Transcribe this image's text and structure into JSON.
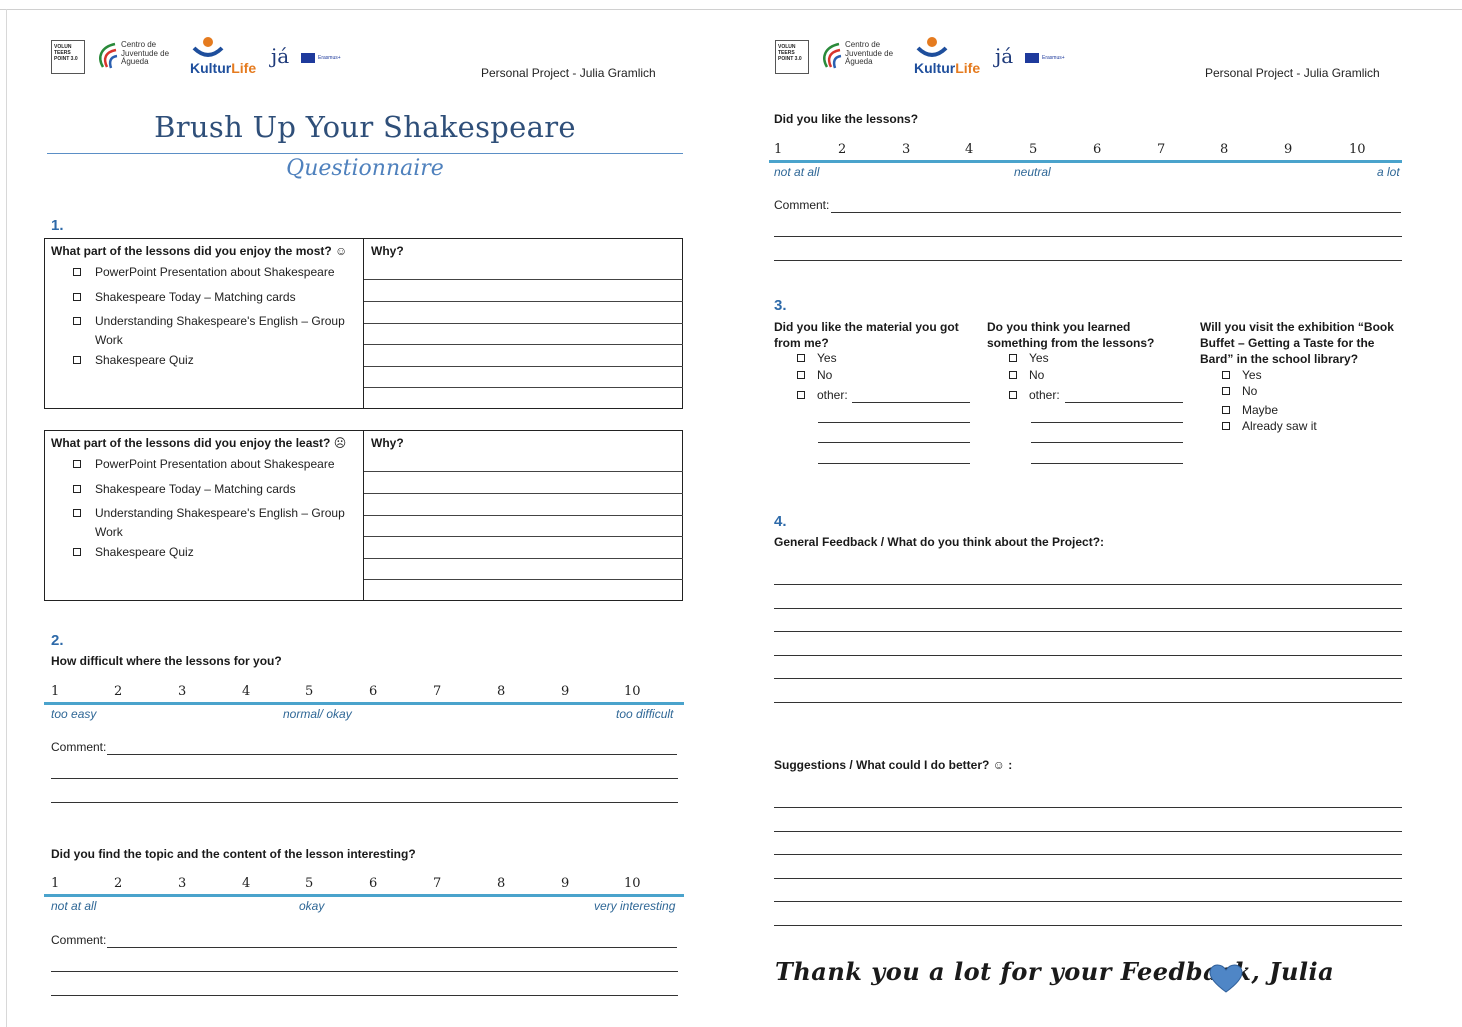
{
  "header": {
    "logos": {
      "volunteers_point": "VOLUN TEERS POINT 3.0",
      "centro_juventude": "Centro de Juventude de Águeda",
      "kulturlife_a": "Kultur",
      "kulturlife_b": "Life",
      "ja": "já",
      "erasmus": "Erasmus+"
    },
    "project_text": "Personal Project - Julia Gramlich"
  },
  "left_page": {
    "title": "Brush Up Your Shakespeare",
    "subtitle": "Questionnaire",
    "section1": {
      "number": "1.",
      "most": {
        "question": "What part of the lessons did you enjoy the most? ☺",
        "why": "Why?",
        "options": [
          "PowerPoint Presentation about Shakespeare",
          "Shakespeare Today – Matching cards",
          "Understanding Shakespeare's English – Group Work",
          "Shakespeare Quiz"
        ]
      },
      "least": {
        "question": "What part of the lessons did you enjoy the least? ☹",
        "why": "Why?",
        "options": [
          "PowerPoint Presentation about Shakespeare",
          "Shakespeare Today – Matching cards",
          "Understanding Shakespeare's English – Group Work",
          "Shakespeare Quiz"
        ]
      }
    },
    "section2": {
      "number": "2.",
      "difficulty": {
        "question": "How difficult where the lessons for you?",
        "scale": [
          "1",
          "2",
          "3",
          "4",
          "5",
          "6",
          "7",
          "8",
          "9",
          "10"
        ],
        "low": "too easy",
        "mid": "normal/ okay",
        "high": "too difficult",
        "comment": "Comment:"
      },
      "interest": {
        "question": "Did you find the topic and the content of the lesson interesting?",
        "scale": [
          "1",
          "2",
          "3",
          "4",
          "5",
          "6",
          "7",
          "8",
          "9",
          "10"
        ],
        "low": "not at all",
        "mid": "okay",
        "high": "very interesting",
        "comment": "Comment:"
      }
    }
  },
  "right_page": {
    "liked": {
      "question": "Did you like the lessons?",
      "scale": [
        "1",
        "2",
        "3",
        "4",
        "5",
        "6",
        "7",
        "8",
        "9",
        "10"
      ],
      "low": "not at all",
      "mid": "neutral",
      "high": "a lot",
      "comment": "Comment:"
    },
    "section3": {
      "number": "3.",
      "material": {
        "question": "Did you like the material you got from me?",
        "options": [
          "Yes",
          "No",
          "other:"
        ]
      },
      "learned": {
        "question": "Do you think you learned something from the lessons?",
        "options": [
          "Yes",
          "No",
          "other:"
        ]
      },
      "exhibition": {
        "question": "Will you visit the exhibition “Book Buffet – Getting a Taste for the Bard” in the school library?",
        "options": [
          "Yes",
          "No",
          "Maybe",
          "Already saw it"
        ]
      }
    },
    "section4": {
      "number": "4.",
      "feedback_question": "General Feedback / What do you think about the Project?:",
      "suggestions_question": "Suggestions / What could I do better? ☺ :"
    },
    "thank_you": "Thank you a lot for your Feedback, Julia",
    "colors": {
      "heart": "#4f86c6",
      "accent": "#4aa3cc",
      "heading": "#2f4f79"
    }
  }
}
